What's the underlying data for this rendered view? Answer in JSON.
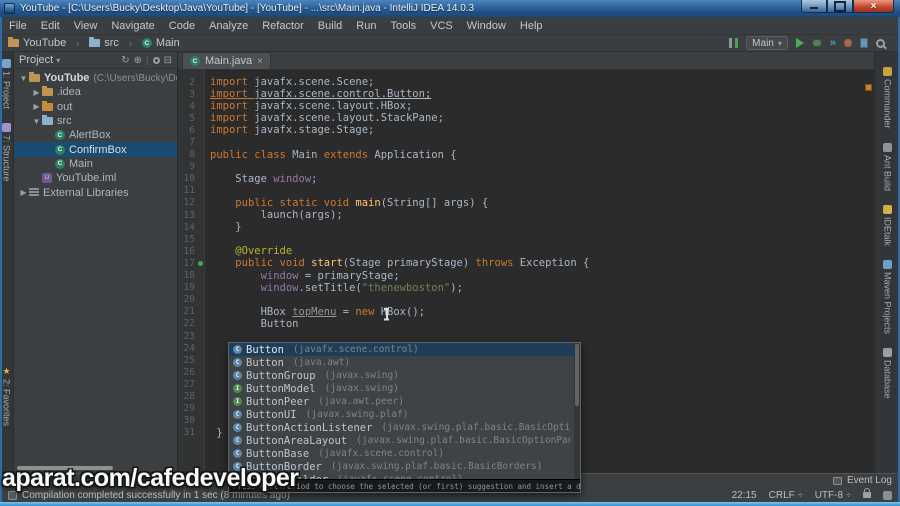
{
  "window": {
    "title": "YouTube - [C:\\Users\\Bucky\\Desktop\\Java\\YouTube] - [YouTube] - ...\\src\\Main.java - IntelliJ IDEA 14.0.3",
    "controls": [
      {
        "name": "minimize-button"
      },
      {
        "name": "maximize-button"
      },
      {
        "name": "close-button"
      }
    ]
  },
  "menu": {
    "items": [
      "File",
      "Edit",
      "View",
      "Navigate",
      "Code",
      "Analyze",
      "Refactor",
      "Build",
      "Run",
      "Tools",
      "VCS",
      "Window",
      "Help"
    ]
  },
  "navbar": {
    "breadcrumbs": [
      {
        "label": "YouTube",
        "icon": "ic-folder"
      },
      {
        "label": "src",
        "icon": "ic-folder-src"
      },
      {
        "label": "Main",
        "icon": "ic-class"
      }
    ],
    "run_config": {
      "label": "Main"
    },
    "pre_tools": [
      {
        "name": "view-modes-icon",
        "type": "columns"
      }
    ],
    "tools": [
      {
        "name": "run-button",
        "type": "play"
      },
      {
        "name": "debug-button",
        "type": "bug"
      },
      {
        "name": "coverage-button",
        "type": "chevrons",
        "glyph": "»"
      },
      {
        "name": "profiler-button",
        "type": "dot"
      },
      {
        "name": "settings-doc-button",
        "type": "doc"
      },
      {
        "name": "search-everywhere-button",
        "type": "magnifier"
      }
    ]
  },
  "left_strip": {
    "top": [
      {
        "label": "1: Project",
        "icon_color": "#7ba3c8"
      },
      {
        "label": "7: Structure",
        "icon_color": "#a98fc9"
      }
    ],
    "bottom": [
      {
        "label": "2: Favorites",
        "star": true
      }
    ]
  },
  "right_strip": [
    {
      "label": "Commander",
      "icon_color": "#c9a23f"
    },
    {
      "label": "Ant Build",
      "icon_color": "#8f9498"
    },
    {
      "label": "IDEtalk",
      "icon_color": "#d0b14e"
    },
    {
      "label": "Maven Projects",
      "icon_color": "#6f9ec9"
    },
    {
      "label": "Database",
      "icon_color": "#9aa0a5"
    }
  ],
  "project": {
    "header": {
      "title": "Project",
      "icons": [
        {
          "name": "sync-button",
          "glyph": "↻"
        },
        {
          "name": "locate-button",
          "glyph": "⊕"
        },
        {
          "name": "divider",
          "glyph": "|"
        },
        {
          "name": "settings-button",
          "glyph": "gear"
        },
        {
          "name": "collapse-button",
          "glyph": "⊟"
        }
      ]
    },
    "tree": [
      {
        "label": "YouTube",
        "suffix": "(C:\\Users\\Bucky\\Desktop",
        "level": 0,
        "arrow": "down",
        "icon": "folder",
        "bold": true
      },
      {
        "label": ".idea",
        "level": 1,
        "arrow": "right",
        "icon": "folder"
      },
      {
        "label": "out",
        "level": 1,
        "arrow": "right",
        "icon": "folder-excluded"
      },
      {
        "label": "src",
        "level": 1,
        "arrow": "down",
        "icon": "folder-src"
      },
      {
        "label": "AlertBox",
        "level": 2,
        "icon": "class"
      },
      {
        "label": "ConfirmBox",
        "level": 2,
        "icon": "class",
        "selected": true
      },
      {
        "label": "Main",
        "level": 2,
        "icon": "class"
      },
      {
        "label": "YouTube.iml",
        "level": 1,
        "icon": "iml"
      },
      {
        "label": "External Libraries",
        "level": 0,
        "arrow": "right",
        "icon": "lib"
      }
    ]
  },
  "editor": {
    "tab": {
      "label": "Main.java",
      "close": "×"
    },
    "lines": [
      {
        "n": "2",
        "seg": [
          {
            "c": "kw",
            "t": "import "
          },
          {
            "c": "pl",
            "t": "javafx.scene.Scene;"
          }
        ]
      },
      {
        "n": "3",
        "seg": [
          {
            "c": "kw un",
            "t": "import "
          },
          {
            "c": "pl un",
            "t": "javafx.scene.control.Button;"
          }
        ]
      },
      {
        "n": "4",
        "seg": [
          {
            "c": "kw",
            "t": "import "
          },
          {
            "c": "pl",
            "t": "javafx.scene.layout.HBox;"
          }
        ]
      },
      {
        "n": "5",
        "seg": [
          {
            "c": "kw",
            "t": "import "
          },
          {
            "c": "pl",
            "t": "javafx.scene.layout.StackPane;"
          }
        ]
      },
      {
        "n": "6",
        "seg": [
          {
            "c": "kw",
            "t": "import "
          },
          {
            "c": "pl",
            "t": "javafx.stage.Stage;"
          }
        ]
      },
      {
        "n": "7",
        "seg": []
      },
      {
        "n": "8",
        "seg": [
          {
            "c": "kw",
            "t": "public class "
          },
          {
            "c": "pl",
            "t": "Main "
          },
          {
            "c": "kw",
            "t": "extends "
          },
          {
            "c": "pl",
            "t": "Application {"
          }
        ]
      },
      {
        "n": "9",
        "seg": []
      },
      {
        "n": "10",
        "seg": [
          {
            "c": "pl",
            "t": "    Stage "
          },
          {
            "c": "fi",
            "t": "window"
          },
          {
            "c": "pl",
            "t": ";"
          }
        ]
      },
      {
        "n": "11",
        "seg": []
      },
      {
        "n": "12",
        "seg": [
          {
            "c": "pl",
            "t": "    "
          },
          {
            "c": "kw",
            "t": "public static void "
          },
          {
            "c": "me",
            "t": "main"
          },
          {
            "c": "pl",
            "t": "(String[] args) {"
          }
        ]
      },
      {
        "n": "13",
        "seg": [
          {
            "c": "pl",
            "t": "        launch(args);"
          }
        ]
      },
      {
        "n": "14",
        "seg": [
          {
            "c": "pl",
            "t": "    }"
          }
        ]
      },
      {
        "n": "15",
        "seg": []
      },
      {
        "n": "16",
        "seg": [
          {
            "c": "pl",
            "t": "    "
          },
          {
            "c": "an",
            "t": "@Override"
          }
        ]
      },
      {
        "n": "17",
        "gutter": "run",
        "seg": [
          {
            "c": "pl",
            "t": "    "
          },
          {
            "c": "kw",
            "t": "public void "
          },
          {
            "c": "me",
            "t": "start"
          },
          {
            "c": "pl",
            "t": "(Stage primaryStage) "
          },
          {
            "c": "kw",
            "t": "throws "
          },
          {
            "c": "pl",
            "t": "Exception {"
          }
        ]
      },
      {
        "n": "18",
        "seg": [
          {
            "c": "pl",
            "t": "        "
          },
          {
            "c": "fi",
            "t": "window"
          },
          {
            "c": "pl",
            "t": " = primaryStage;"
          }
        ]
      },
      {
        "n": "19",
        "seg": [
          {
            "c": "pl",
            "t": "        "
          },
          {
            "c": "fi",
            "t": "window"
          },
          {
            "c": "pl",
            "t": ".setTitle("
          },
          {
            "c": "st",
            "t": "\"thenewboston\""
          },
          {
            "c": "pl",
            "t": ");"
          }
        ]
      },
      {
        "n": "20",
        "seg": []
      },
      {
        "n": "21",
        "seg": [
          {
            "c": "pl",
            "t": "        HBox "
          },
          {
            "c": "un2",
            "t": "topMenu"
          },
          {
            "c": "pl",
            "t": " = "
          },
          {
            "c": "kw",
            "t": "new "
          },
          {
            "c": "pl",
            "t": "HBox();"
          }
        ]
      },
      {
        "n": "22",
        "seg": [
          {
            "c": "pl",
            "t": "        Button"
          }
        ]
      },
      {
        "n": "23",
        "seg": []
      },
      {
        "n": "24",
        "seg": []
      },
      {
        "n": "25",
        "seg": []
      },
      {
        "n": "26",
        "seg": []
      },
      {
        "n": "27",
        "seg": []
      },
      {
        "n": "28",
        "seg": []
      },
      {
        "n": "29",
        "seg": []
      },
      {
        "n": "30",
        "seg": []
      },
      {
        "n": "31",
        "seg": [
          {
            "c": "pl",
            "t": " }"
          }
        ]
      }
    ]
  },
  "popup": {
    "items": [
      {
        "name": "Button",
        "detail": "(javafx.scene.control)",
        "kind": "C",
        "selected": true
      },
      {
        "name": "Button",
        "detail": "(java.awt)",
        "kind": "C"
      },
      {
        "name": "ButtonGroup",
        "detail": "(javax.swing)",
        "kind": "C"
      },
      {
        "name": "ButtonModel",
        "detail": "(javax.swing)",
        "kind": "I"
      },
      {
        "name": "ButtonPeer",
        "detail": "(java.awt.peer)",
        "kind": "I"
      },
      {
        "name": "ButtonUI",
        "detail": "(javax.swing.plaf)",
        "kind": "C"
      },
      {
        "name": "ButtonActionListener",
        "detail": "(javax.swing.plaf.basic.BasicOptionPaneUI)",
        "kind": "C"
      },
      {
        "name": "ButtonAreaLayout",
        "detail": "(javax.swing.plaf.basic.BasicOptionPaneUI)",
        "kind": "C"
      },
      {
        "name": "ButtonBase",
        "detail": "(javafx.scene.control)",
        "kind": "C"
      },
      {
        "name": "ButtonBorder",
        "detail": "(javax.swing.plaf.basic.BasicBorders)",
        "kind": "C"
      },
      {
        "name": "ButtonBuilder",
        "detail": "(javafx.scene.control)",
        "kind": "C"
      }
    ],
    "hint": "Press Ctrl+Period to choose the selected (or first) suggestion and insert a dot afterwards »",
    "sort_icon": "π"
  },
  "status": {
    "event_log": "Event Log",
    "message": "Compilation completed successfully in 1 sec (8 minutes ago)",
    "caret": "22:15",
    "line_sep": "CRLF",
    "encoding": "UTF-8",
    "sep_glyph": "÷"
  },
  "watermark": "aparat.com/cafedeveloper",
  "colors": {
    "editor_bg": "#2b2b2b",
    "panel_bg": "#3c3f41",
    "selection_blue": "#1c4b72",
    "keyword_orange": "#cc7832",
    "string_green": "#6a8759",
    "annotation_yellow": "#bbb529",
    "method_yellow": "#ffc66d",
    "field_purple": "#9876aa",
    "run_green": "#49b04a",
    "close_red": "#c64b32",
    "bottom_edge_blue": "#54b7ef"
  }
}
